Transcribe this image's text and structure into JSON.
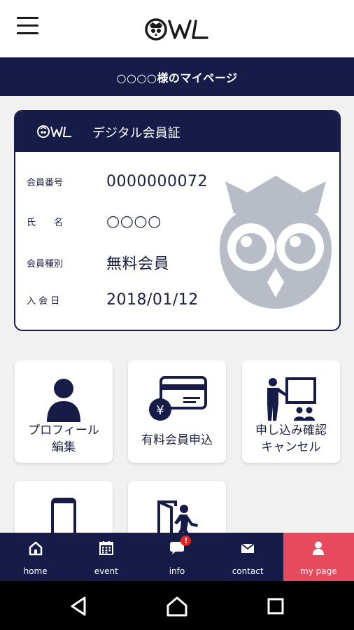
{
  "header": {
    "menu_icon": "hamburger-icon",
    "logo_text": "OWL"
  },
  "title_bar": {
    "title": "○○○○様のマイページ"
  },
  "member_card": {
    "title": "デジタル会員証",
    "rows": [
      {
        "label": "会員番号",
        "value": "0000000072"
      },
      {
        "label": "氏　　名",
        "value": "○○○○"
      },
      {
        "label": "会員種別",
        "value": "無料会員"
      },
      {
        "label": "入 会 日",
        "value": "2018/01/12"
      }
    ]
  },
  "tiles": [
    {
      "label": "プロフィール\n編集",
      "icon": "person-icon"
    },
    {
      "label": "有料会員申込",
      "icon": "credit-card-yen-icon"
    },
    {
      "label": "申し込み確認\nキャンセル",
      "icon": "presentation-icon"
    },
    {
      "label": "",
      "icon": "smartphone-icon"
    },
    {
      "label": "",
      "icon": "exit-icon"
    }
  ],
  "tab_bar": {
    "tabs": [
      {
        "label": "home",
        "icon": "home-icon"
      },
      {
        "label": "event",
        "icon": "calendar-icon"
      },
      {
        "label": "info",
        "icon": "chat-icon",
        "badge": "!"
      },
      {
        "label": "contact",
        "icon": "mail-icon"
      },
      {
        "label": "my page",
        "icon": "user-icon"
      }
    ],
    "active": "my page"
  },
  "colors": {
    "navy": "#161b47",
    "accent": "#e64a5c",
    "badge": "#e8221c"
  }
}
